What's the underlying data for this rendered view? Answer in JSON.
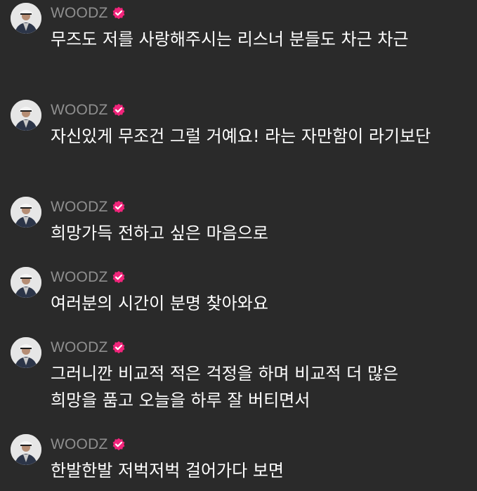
{
  "author": "WOODZ",
  "icons": {
    "avatar": "avatar-icon",
    "verified": "verified-badge-icon"
  },
  "colors": {
    "background": "#2a2a2a",
    "author": "#8f8f8f",
    "text": "#ffffff",
    "verified": "#f2247b"
  },
  "messages": [
    {
      "text": "무즈도 저를 사랑해주시는 리스너 분들도 차근 차근"
    },
    {
      "text": "자신있게 무조건 그럴 거예요! 라는 자만함이 라기보단"
    },
    {
      "text": "희망가득 전하고 싶은 마음으로"
    },
    {
      "text": "여러분의 시간이 분명 찾아와요"
    },
    {
      "text": "그러니깐 비교적 적은 걱정을 하며 비교적 더 많은 희망을 품고 오늘을 하루 잘 버티면서"
    },
    {
      "text": "한발한발 저벅저벅 걸어가다 보면"
    }
  ]
}
